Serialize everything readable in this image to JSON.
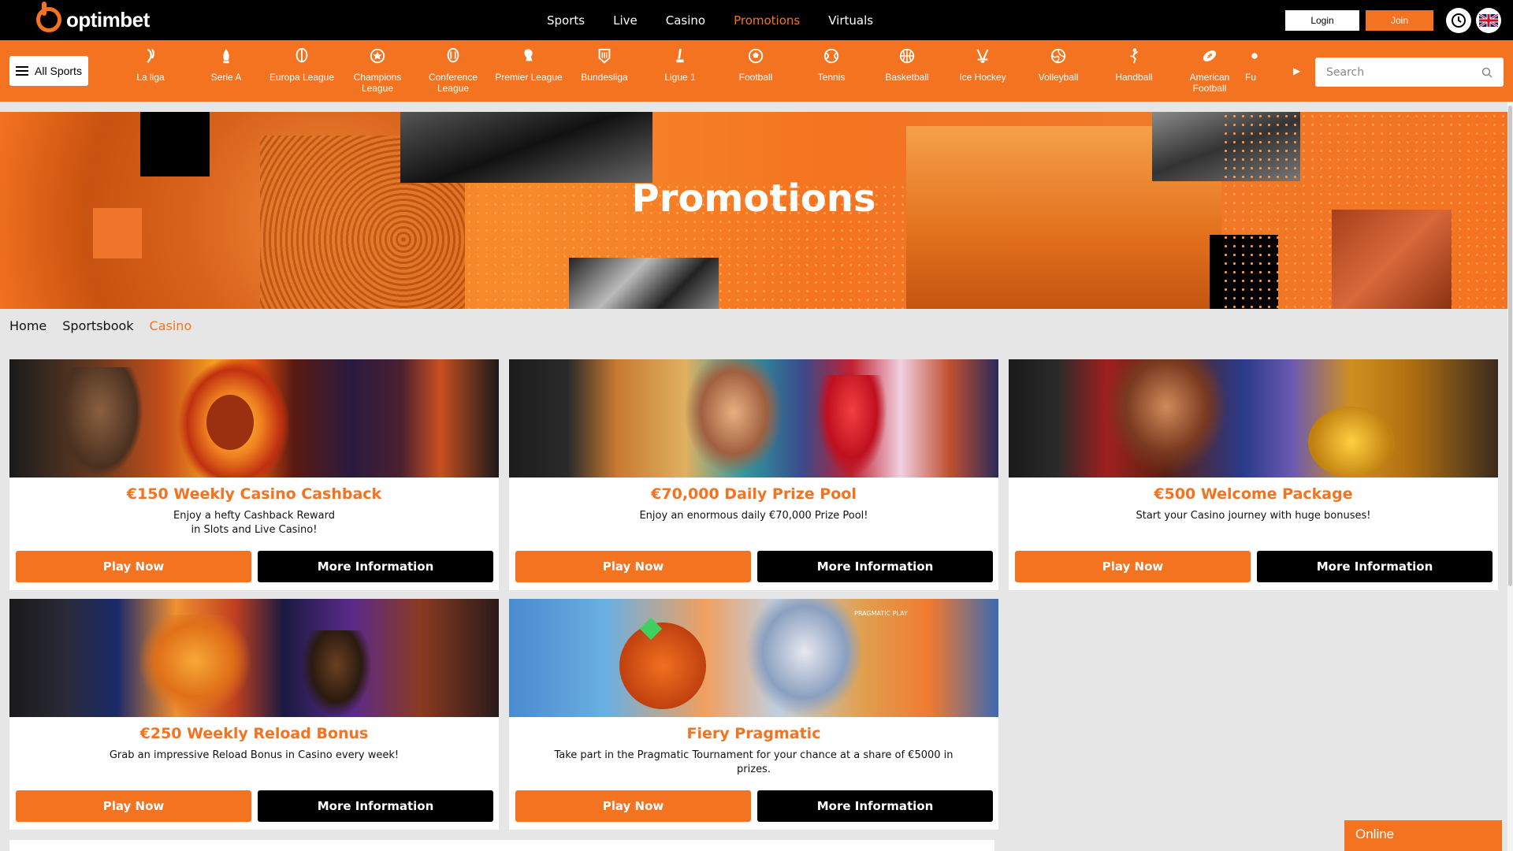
{
  "brand": {
    "name": "optimbet",
    "accent": "#f47321"
  },
  "nav": {
    "items": [
      "Sports",
      "Live",
      "Casino",
      "Promotions",
      "Virtuals"
    ],
    "active": "Promotions"
  },
  "auth": {
    "login_label": "Login",
    "join_label": "Join"
  },
  "header_icons": {
    "history": "clock-icon",
    "language": "uk-flag-icon"
  },
  "sports_bar": {
    "all_sports_label": "All Sports",
    "items": [
      {
        "label": "La liga",
        "icon": "laliga-icon"
      },
      {
        "label": "Serie A",
        "icon": "seriea-icon"
      },
      {
        "label": "Europa League",
        "icon": "europa-league-icon"
      },
      {
        "label": "Champions League",
        "icon": "champions-league-icon"
      },
      {
        "label": "Conference League",
        "icon": "conference-league-icon"
      },
      {
        "label": "Premier League",
        "icon": "premier-league-icon"
      },
      {
        "label": "Bundesliga",
        "icon": "bundesliga-icon"
      },
      {
        "label": "Ligue 1",
        "icon": "ligue1-icon"
      },
      {
        "label": "Football",
        "icon": "football-icon"
      },
      {
        "label": "Tennis",
        "icon": "tennis-icon"
      },
      {
        "label": "Basketball",
        "icon": "basketball-icon"
      },
      {
        "label": "Ice Hockey",
        "icon": "ice-hockey-icon"
      },
      {
        "label": "Volleyball",
        "icon": "volleyball-icon"
      },
      {
        "label": "Handball",
        "icon": "handball-icon"
      },
      {
        "label": "American Football",
        "icon": "american-football-icon"
      },
      {
        "label": "Fu",
        "icon": "futsal-icon"
      }
    ],
    "search_placeholder": "Search"
  },
  "hero": {
    "title": "Promotions"
  },
  "breadcrumb": [
    "Home",
    "Sportsbook",
    "Casino"
  ],
  "promotions": [
    {
      "title": "€150 Weekly Casino Cashback",
      "description": "Enjoy a hefty Cashback Reward\nin Slots and Live Casino!",
      "play_label": "Play Now",
      "info_label": "More Information"
    },
    {
      "title": "€70,000 Daily Prize Pool",
      "description": "Enjoy an enormous daily €70,000 Prize Pool!",
      "play_label": "Play Now",
      "info_label": "More Information"
    },
    {
      "title": "€500 Welcome Package",
      "description": "Start your Casino journey with huge bonuses!",
      "play_label": "Play Now",
      "info_label": "More Information"
    },
    {
      "title": "€250 Weekly Reload Bonus",
      "description": "Grab an impressive Reload Bonus in Casino every week!",
      "play_label": "Play Now",
      "info_label": "More Information"
    },
    {
      "title": "Fiery Pragmatic",
      "description": "Take part in the Pragmatic Tournament for your chance at a share of €5000 in prizes.",
      "play_label": "Play Now",
      "info_label": "More Information",
      "image_badge": "PRAGMATIC PLAY"
    }
  ],
  "chat": {
    "status_label": "Online"
  }
}
